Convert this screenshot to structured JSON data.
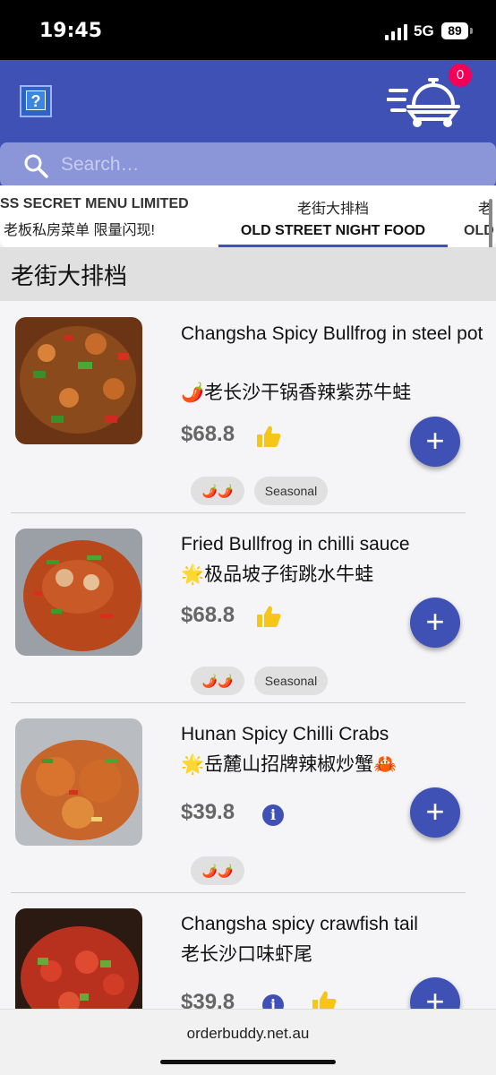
{
  "status_bar": {
    "time": "19:45",
    "network": "5G",
    "battery": "89"
  },
  "header": {
    "help_label": "?",
    "cart_count": "0",
    "search_placeholder": "Search…"
  },
  "tabs": [
    {
      "zh": "",
      "en": "SS SECRET MENU LIMITED",
      "zh_sub": "老板私房菜单 限量闪现!"
    },
    {
      "zh": "老街大排档",
      "en": "OLD STREET NIGHT FOOD"
    },
    {
      "zh": "老",
      "en": "OLD"
    }
  ],
  "section_title": "老街大排档",
  "items": [
    {
      "name_en": "Changsha Spicy Bullfrog in steel pot",
      "name_zh": "🌶️老长沙干锅香辣紫苏牛蛙",
      "price": "$68.8",
      "badge_icon": "thumbs-up",
      "tags": [
        "🌶️🌶️",
        "Seasonal"
      ]
    },
    {
      "name_en": "Fried Bullfrog in chilli sauce",
      "name_zh": "🌟极品坡子街跳水牛蛙",
      "price": "$68.8",
      "badge_icon": "thumbs-up",
      "tags": [
        "🌶️🌶️",
        "Seasonal"
      ]
    },
    {
      "name_en": "Hunan Spicy Chilli Crabs",
      "name_zh": "🌟岳麓山招牌辣椒炒蟹🦀",
      "price": "$39.8",
      "badge_icon": "info",
      "tags": [
        "🌶️🌶️"
      ]
    },
    {
      "name_en": "Changsha spicy crawfish tail",
      "name_zh": "老长沙口味虾尾",
      "price": "$39.8",
      "badge_icon": "info"
    }
  ],
  "footer": {
    "url": "orderbuddy.net.au"
  },
  "colors": {
    "primary": "#3f51b5",
    "badge": "#f50057",
    "thumb": "#f5c518"
  }
}
